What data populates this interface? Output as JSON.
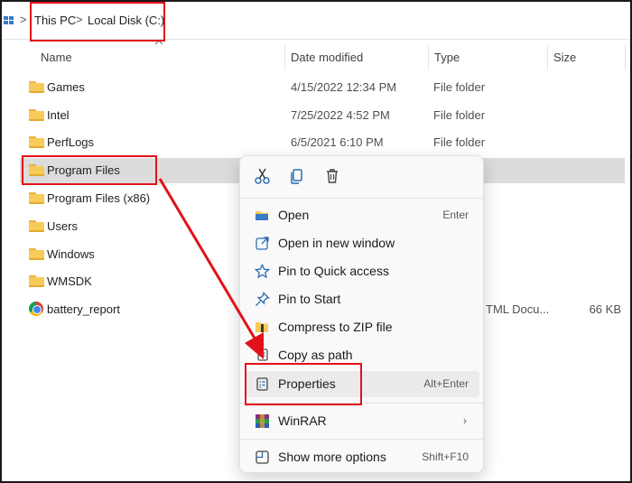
{
  "breadcrumb": {
    "items": [
      "This PC",
      "Local Disk (C:)"
    ],
    "separator": ">"
  },
  "columns": {
    "name": "Name",
    "date_modified": "Date modified",
    "type": "Type",
    "size": "Size"
  },
  "files": [
    {
      "name": "Games",
      "date": "4/15/2022 12:34 PM",
      "type": "File folder",
      "size": "",
      "icon": "folder-icon"
    },
    {
      "name": "Intel",
      "date": "7/25/2022 4:52 PM",
      "type": "File folder",
      "size": "",
      "icon": "folder-icon"
    },
    {
      "name": "PerfLogs",
      "date": "6/5/2021 6:10 PM",
      "type": "File folder",
      "size": "",
      "icon": "folder-icon"
    },
    {
      "name": "Program Files",
      "date": "",
      "type": "",
      "size": "",
      "icon": "folder-icon",
      "selected": true
    },
    {
      "name": "Program Files (x86)",
      "date": "",
      "type": "",
      "size": "",
      "icon": "folder-icon"
    },
    {
      "name": "Users",
      "date": "",
      "type": "",
      "size": "",
      "icon": "folder-icon"
    },
    {
      "name": "Windows",
      "date": "",
      "type": "",
      "size": "",
      "icon": "folder-icon"
    },
    {
      "name": "WMSDK",
      "date": "",
      "type": "",
      "size": "",
      "icon": "folder-icon"
    },
    {
      "name": "battery_report",
      "date": "",
      "type": "TML Docu...",
      "size": "66 KB",
      "icon": "chrome-icon"
    }
  ],
  "context_menu": {
    "quick_actions": [
      "cut-icon",
      "copy-icon",
      "delete-icon"
    ],
    "items": [
      {
        "label": "Open",
        "shortcut": "Enter",
        "icon": "open-folder-icon"
      },
      {
        "label": "Open in new window",
        "shortcut": "",
        "icon": "open-new-window-icon"
      },
      {
        "label": "Pin to Quick access",
        "shortcut": "",
        "icon": "star-icon"
      },
      {
        "label": "Pin to Start",
        "shortcut": "",
        "icon": "pin-icon"
      },
      {
        "label": "Compress to ZIP file",
        "shortcut": "",
        "icon": "zip-icon"
      },
      {
        "label": "Copy as path",
        "shortcut": "",
        "icon": "copy-path-icon"
      },
      {
        "label": "Properties",
        "shortcut": "Alt+Enter",
        "icon": "properties-icon"
      },
      {
        "label": "WinRAR",
        "shortcut": "",
        "icon": "winrar-icon",
        "submenu": true
      },
      {
        "label": "Show more options",
        "shortcut": "Shift+F10",
        "icon": "more-options-icon"
      }
    ]
  },
  "colors": {
    "highlight_red": "#e3111a",
    "accent_blue": "#3a78c9",
    "folder_yellow": "#f6cb5a",
    "selection_gray": "#dcdcdc"
  }
}
